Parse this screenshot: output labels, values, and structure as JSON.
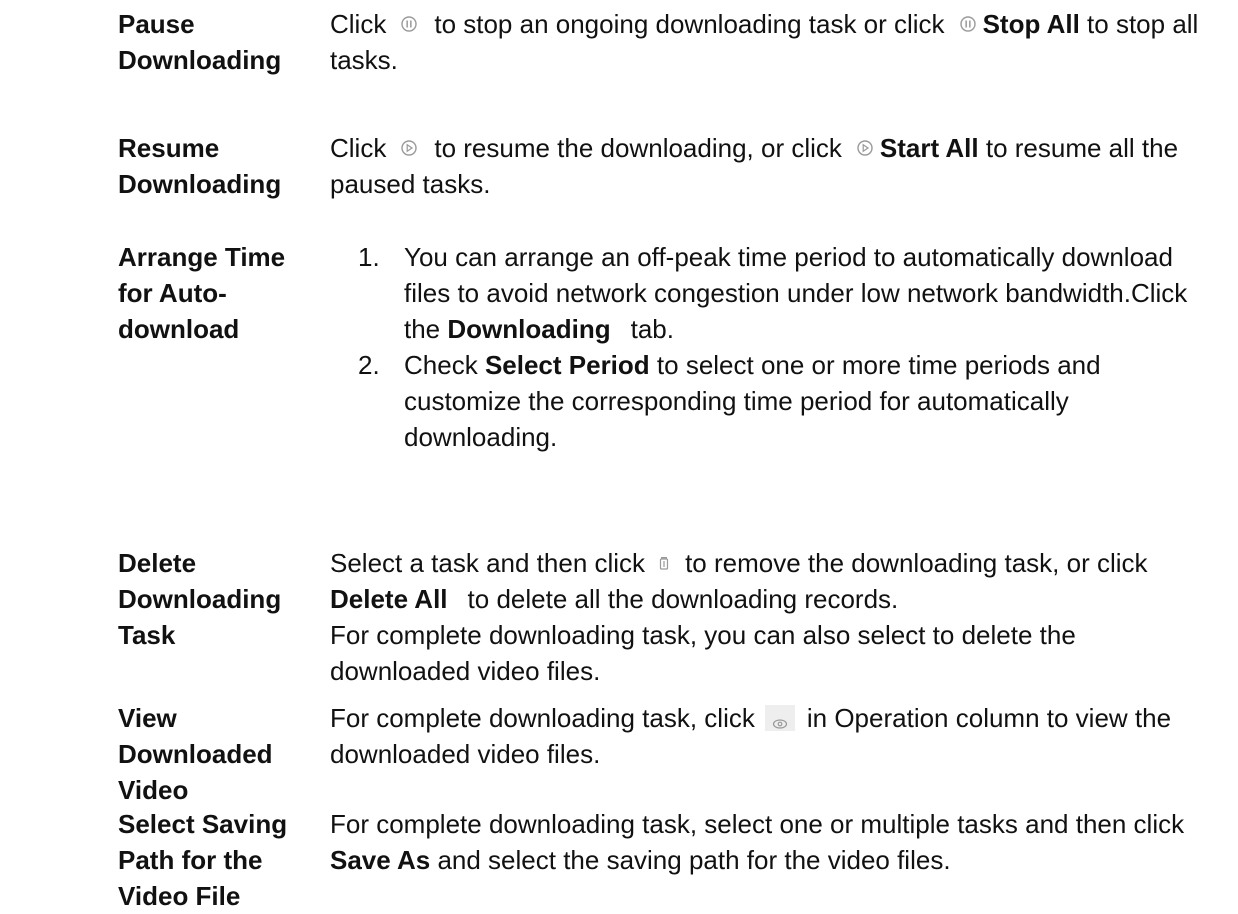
{
  "rows": {
    "pause": {
      "term": "Pause Downloading",
      "t1": "Click",
      "t2": "to stop an ongoing downloading task or click",
      "t3": "Stop All",
      "t4": "to stop all tasks."
    },
    "resume": {
      "term": "Resume Downloading",
      "t1": "Click",
      "t2": "to resume the downloading, or click",
      "t3": "Start All",
      "t4": "to resume all the paused tasks."
    },
    "arrange": {
      "term": "Arrange Time for Auto-download",
      "s1_num": "1.",
      "s1_a": "You can arrange an off-peak time period to automatically download files to avoid network congestion under low network bandwidth.Click the",
      "s1_b": "Downloading",
      "s1_c": "tab.",
      "s2_num": "2.",
      "s2_a": "Check",
      "s2_b": "Select Period",
      "s2_c": "to select one or more time periods and customize the corresponding time period for automatically downloading."
    },
    "delete": {
      "term": "Delete Downloading Task",
      "t1": "Select a task and then click",
      "t2": "to remove the downloading task, or click",
      "t3": "Delete All",
      "t4": "to delete all the downloading records.",
      "t5": "For complete downloading task, you can also select to delete the downloaded video files."
    },
    "view": {
      "term": "View Downloaded Video",
      "t1": "For complete downloading task, click",
      "t2": "in Operation column to view the downloaded video files."
    },
    "save": {
      "term": "Select Saving Path for the Video File",
      "t1": "For complete downloading task, select one or multiple tasks and then click",
      "t2": "Save As",
      "t3": "and select the saving path for the video files."
    }
  },
  "icons": {
    "pause": "pause-circle-icon",
    "play": "play-circle-icon",
    "trash": "trash-icon",
    "eye": "eye-icon",
    "icon_color": "#9a9a9a"
  }
}
